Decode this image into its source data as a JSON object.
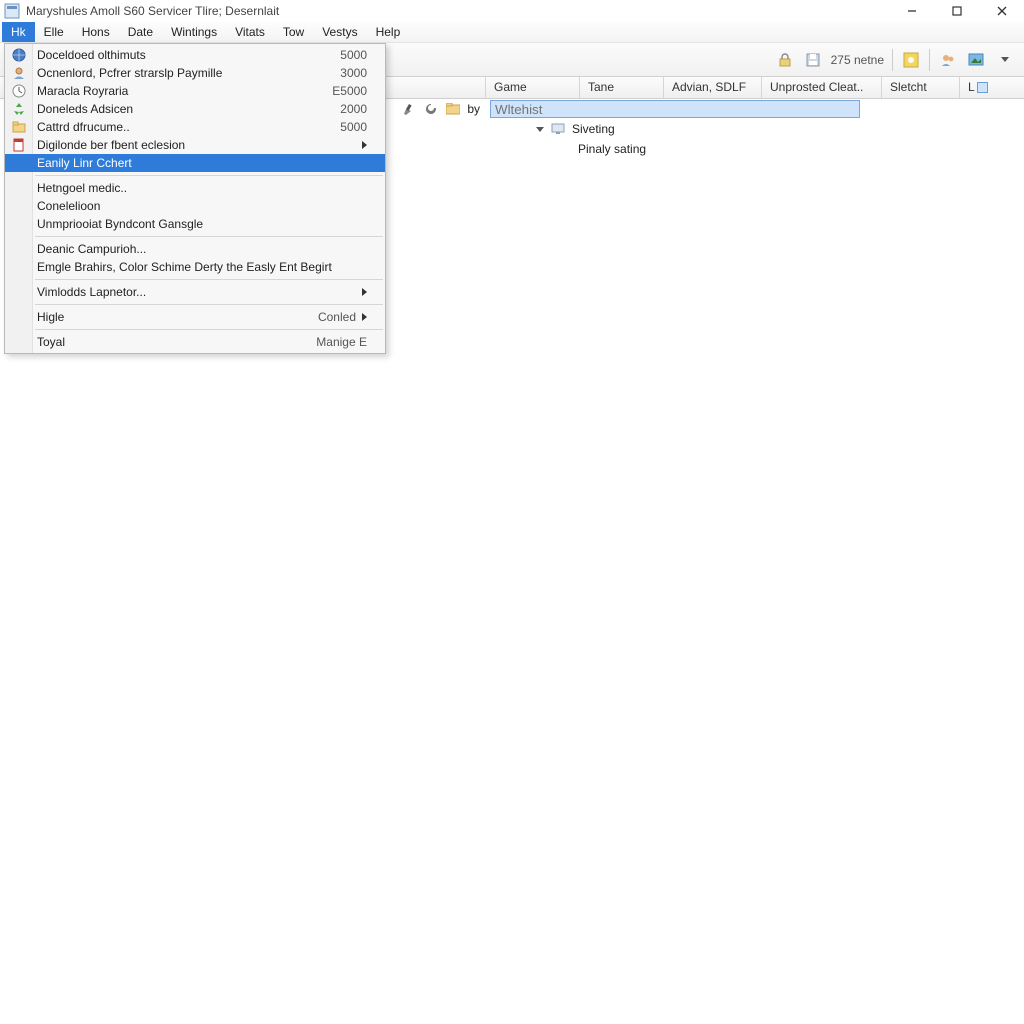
{
  "window": {
    "title": "Maryshules Amoll S60 Servicer Tlire; Desernlait"
  },
  "menubar": [
    {
      "id": "hk",
      "label": "Hk",
      "active": true
    },
    {
      "id": "elle",
      "label": "Elle"
    },
    {
      "id": "hons",
      "label": "Hons"
    },
    {
      "id": "date",
      "label": "Date"
    },
    {
      "id": "wintings",
      "label": "Wintings"
    },
    {
      "id": "vitats",
      "label": "Vitats"
    },
    {
      "id": "tow",
      "label": "Tow"
    },
    {
      "id": "vestys",
      "label": "Vestys"
    },
    {
      "id": "help",
      "label": "Help"
    }
  ],
  "dropdown": {
    "items": [
      {
        "icon": "globe-icon",
        "label": "Doceldoed olthimuts",
        "accel": "5000"
      },
      {
        "icon": "person-icon",
        "label": "Ocnenlord, Pcfrer strarslp Paymille",
        "accel": "3000"
      },
      {
        "icon": "clock-icon",
        "label": "Maracla Royraria",
        "accel": "E5000"
      },
      {
        "icon": "recycle-icon",
        "label": "Doneleds Adsicen",
        "accel": "2000"
      },
      {
        "icon": "folder-icon",
        "label": "Cattrd dfrucume..",
        "accel": "5000"
      },
      {
        "icon": "doc-icon",
        "label": "Digilonde ber fbent eclesion",
        "submenu": true
      },
      {
        "highlight": true,
        "label": "Eanily Linr Cchert",
        "indent": true
      },
      {
        "sep": true
      },
      {
        "label": "Hetngoel medic.."
      },
      {
        "label": "Conelelioon"
      },
      {
        "label": "Unmpriooiat Byndcont Gansgle"
      },
      {
        "sep": true
      },
      {
        "label": "Deanic Campurioh..."
      },
      {
        "label": "Emgle Brahirs, Color Schime Derty the Easly Ent Begirt"
      },
      {
        "sep": true
      },
      {
        "label": "Vimlodds Lapnetor...",
        "submenu": true
      },
      {
        "sep": true
      },
      {
        "label": "Higle",
        "accel": "Conled",
        "submenu": true
      },
      {
        "sep": true
      },
      {
        "label": "Toyal",
        "accel": "Manige E"
      }
    ]
  },
  "toolbar": {
    "count_label": "275 netne"
  },
  "columns": {
    "game": "Game",
    "tane": "Tane",
    "advian": "Advian, SDLF",
    "unprosted": "Unprosted Cleat..",
    "sletcht": "Sletcht",
    "last": "L"
  },
  "rows": {
    "r1": {
      "by": "by",
      "placeholder": "Wltehist"
    },
    "r2": {
      "label": "Siveting"
    },
    "r3": {
      "label": "Pinaly sating"
    }
  }
}
